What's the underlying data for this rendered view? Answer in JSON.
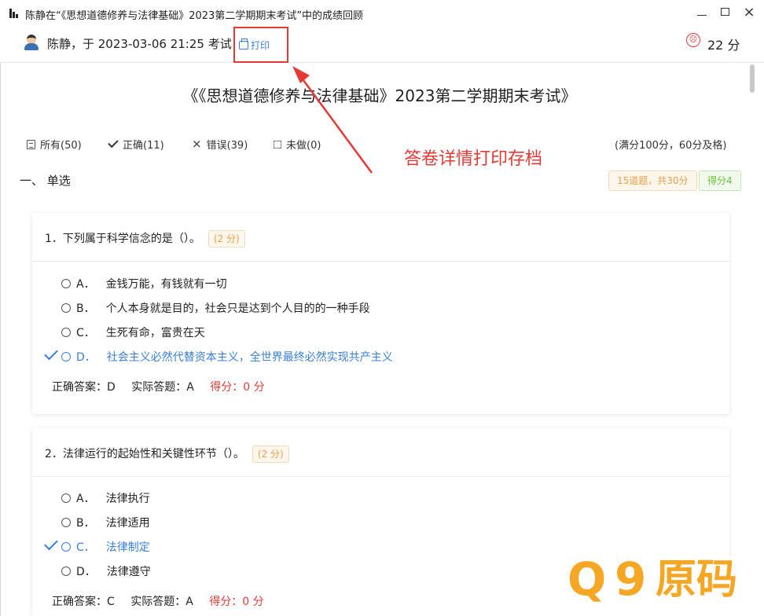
{
  "window": {
    "title": "陈静在“《思想道德修养与法律基础》2023第二学期期末考试”中的成绩回顾",
    "icon": "bar-chart-icon",
    "minimize": "minimize-icon",
    "maximize": "maximize-icon",
    "close": "×"
  },
  "header": {
    "user_line": "陈静，于 2023-03-06 21:25 考试",
    "print_label": "打印",
    "score_face": "☹",
    "score": "22 分"
  },
  "exam": {
    "title": "《《思想道德修养与法律基础》2023第二学期期末考试》"
  },
  "filters": {
    "all": "所有(50)",
    "correct": "正确(11)",
    "wrong": "错误(39)",
    "undone": "未做(0)",
    "full_score_note": "(满分100分，60分及格)",
    "wrong_mark": "×"
  },
  "annotation": {
    "text": "答卷详情打印存档",
    "color": "#e53935"
  },
  "section": {
    "title": "一、 单选",
    "count_tag": "15道题，共30分",
    "got_tag": "得分4"
  },
  "questions": [
    {
      "text": "1．下列属于科学信念的是（）。",
      "points": "(2 分)",
      "options": [
        {
          "letter": "A．",
          "text": "金钱万能，有钱就有一切"
        },
        {
          "letter": "B．",
          "text": "个人本身就是目的，社会只是达到个人目的的一种手段"
        },
        {
          "letter": "C．",
          "text": "生死有命，富贵在天"
        },
        {
          "letter": "D．",
          "text": "社会主义必然代替资本主义，全世界最终必然实现共产主义"
        }
      ],
      "correct_answer": "正确答案：D",
      "actual_answer": "实际答题：A",
      "got": "得分：0 分"
    },
    {
      "text": "2．法律运行的起始性和关键性环节（）。",
      "points": "(2 分)",
      "options": [
        {
          "letter": "A．",
          "text": "法律执行"
        },
        {
          "letter": "B．",
          "text": "法律适用"
        },
        {
          "letter": "C．",
          "text": "法律制定"
        },
        {
          "letter": "D．",
          "text": "法律遵守"
        }
      ],
      "correct_answer": "正确答案：C",
      "actual_answer": "实际答题：A",
      "got": "得分：0 分"
    }
  ],
  "watermark": {
    "q": "Q",
    "nine": "9",
    "text": "原码"
  },
  "colors": {
    "accent_blue": "#3a7fd5",
    "error_red": "#e53935",
    "warning_orange": "#e8a04a",
    "success_green": "#67c23a",
    "watermark_orange": "#f5a623"
  }
}
